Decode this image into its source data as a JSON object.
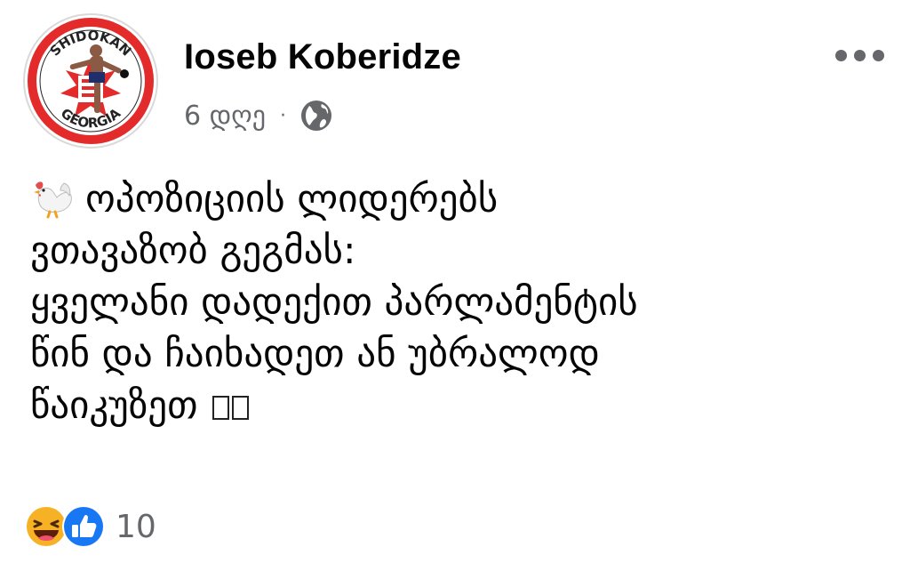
{
  "post": {
    "author": "Ioseb Koberidze",
    "avatar": {
      "logo_top_text": "SHIDOKAN",
      "logo_bottom_text": "GEORGIA"
    },
    "timestamp": "6 დღე",
    "separator": "·",
    "privacy_icon": "globe-icon",
    "more_icon": "more-horizontal-icon",
    "body_lines": [
      "ოპოზიციის ლიდერებს",
      "ვთავაზობ გეგმას:",
      "ყველანი დადექით პარლამენტის",
      "წინ და ჩაიხადეთ ან უბრალოდ",
      "წაიკუზეთ"
    ],
    "leading_emoji": "rooster-emoji",
    "trailing_glyphs": "missing-glyph-boxes"
  },
  "reactions": {
    "types": [
      "haha",
      "like"
    ],
    "count": "10"
  },
  "colors": {
    "text": "#050505",
    "secondary": "#65676b",
    "like_blue": "#1877f2",
    "haha_yellow": "#f7b125",
    "logo_red": "#e32b2b"
  }
}
